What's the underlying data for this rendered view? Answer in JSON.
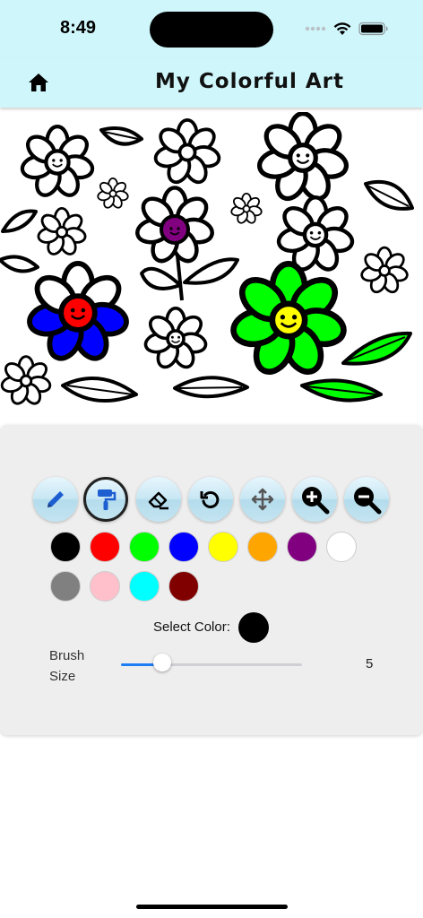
{
  "status": {
    "time": "8:49"
  },
  "header": {
    "title": "My Colorful Art",
    "home_icon": "home-icon"
  },
  "tools": [
    {
      "name": "pencil",
      "icon": "pencil-icon",
      "active": false
    },
    {
      "name": "fill",
      "icon": "paint-roller-icon",
      "active": true
    },
    {
      "name": "eraser",
      "icon": "eraser-icon",
      "active": false
    },
    {
      "name": "undo",
      "icon": "undo-icon",
      "active": false
    },
    {
      "name": "move",
      "icon": "move-icon",
      "active": false
    },
    {
      "name": "zoom-in",
      "icon": "zoom-in-icon",
      "active": false
    },
    {
      "name": "zoom-out",
      "icon": "zoom-out-icon",
      "active": false
    }
  ],
  "palette": [
    "#000000",
    "#ff0000",
    "#00ff00",
    "#0000ff",
    "#ffff00",
    "#ffa500",
    "#800080",
    "#ffffff",
    "#808080",
    "#ffc0cb",
    "#00ffff",
    "#800000"
  ],
  "select_color": {
    "label": "Select Color:",
    "value": "#000000"
  },
  "brush": {
    "label": "Brush Size",
    "value": "5",
    "fraction": 0.23
  },
  "artwork": {
    "fills": {
      "red_flower": "#ff0000",
      "red_petals": "#0000ff",
      "purple_flower": "#800080",
      "green_flower": "#00ff00",
      "green_center": "#ffff00",
      "leaf": "#00ff00"
    }
  }
}
